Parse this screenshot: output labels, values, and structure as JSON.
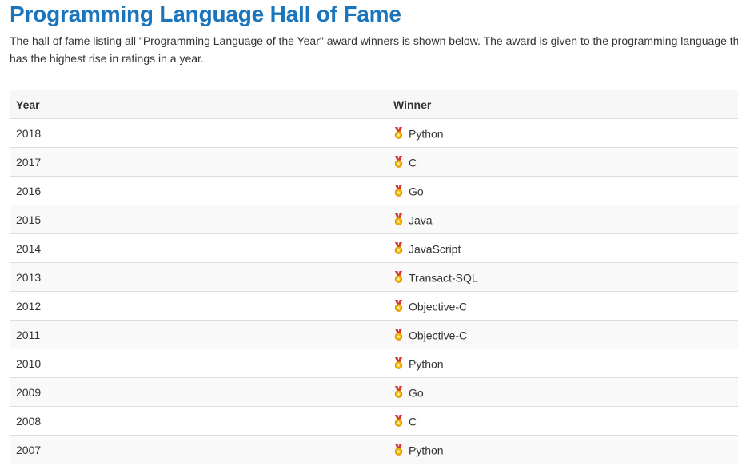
{
  "page": {
    "title": "Programming Language Hall of Fame",
    "intro_line1": "The hall of fame listing all \"Programming Language of the Year\" award winners is shown below. The award is given to the programming language that",
    "intro_line2": "has the highest rise in ratings in a year."
  },
  "table": {
    "headers": {
      "year": "Year",
      "winner": "Winner"
    },
    "rows": [
      {
        "year": "2018",
        "winner": "Python",
        "icon": "medal-icon"
      },
      {
        "year": "2017",
        "winner": "C",
        "icon": "medal-icon"
      },
      {
        "year": "2016",
        "winner": "Go",
        "icon": "medal-icon"
      },
      {
        "year": "2015",
        "winner": "Java",
        "icon": "medal-icon"
      },
      {
        "year": "2014",
        "winner": "JavaScript",
        "icon": "medal-icon"
      },
      {
        "year": "2013",
        "winner": "Transact-SQL",
        "icon": "medal-icon"
      },
      {
        "year": "2012",
        "winner": "Objective-C",
        "icon": "medal-icon"
      },
      {
        "year": "2011",
        "winner": "Objective-C",
        "icon": "medal-icon"
      },
      {
        "year": "2010",
        "winner": "Python",
        "icon": "medal-icon"
      },
      {
        "year": "2009",
        "winner": "Go",
        "icon": "medal-icon"
      },
      {
        "year": "2008",
        "winner": "C",
        "icon": "medal-icon"
      },
      {
        "year": "2007",
        "winner": "Python",
        "icon": "medal-icon"
      }
    ]
  },
  "colors": {
    "title": "#1a75bc",
    "text": "#333333",
    "border": "#dddddd",
    "stripe": "#f9f9f9",
    "medal_ribbon": "#d9342b",
    "medal_gold": "#f5b400"
  }
}
